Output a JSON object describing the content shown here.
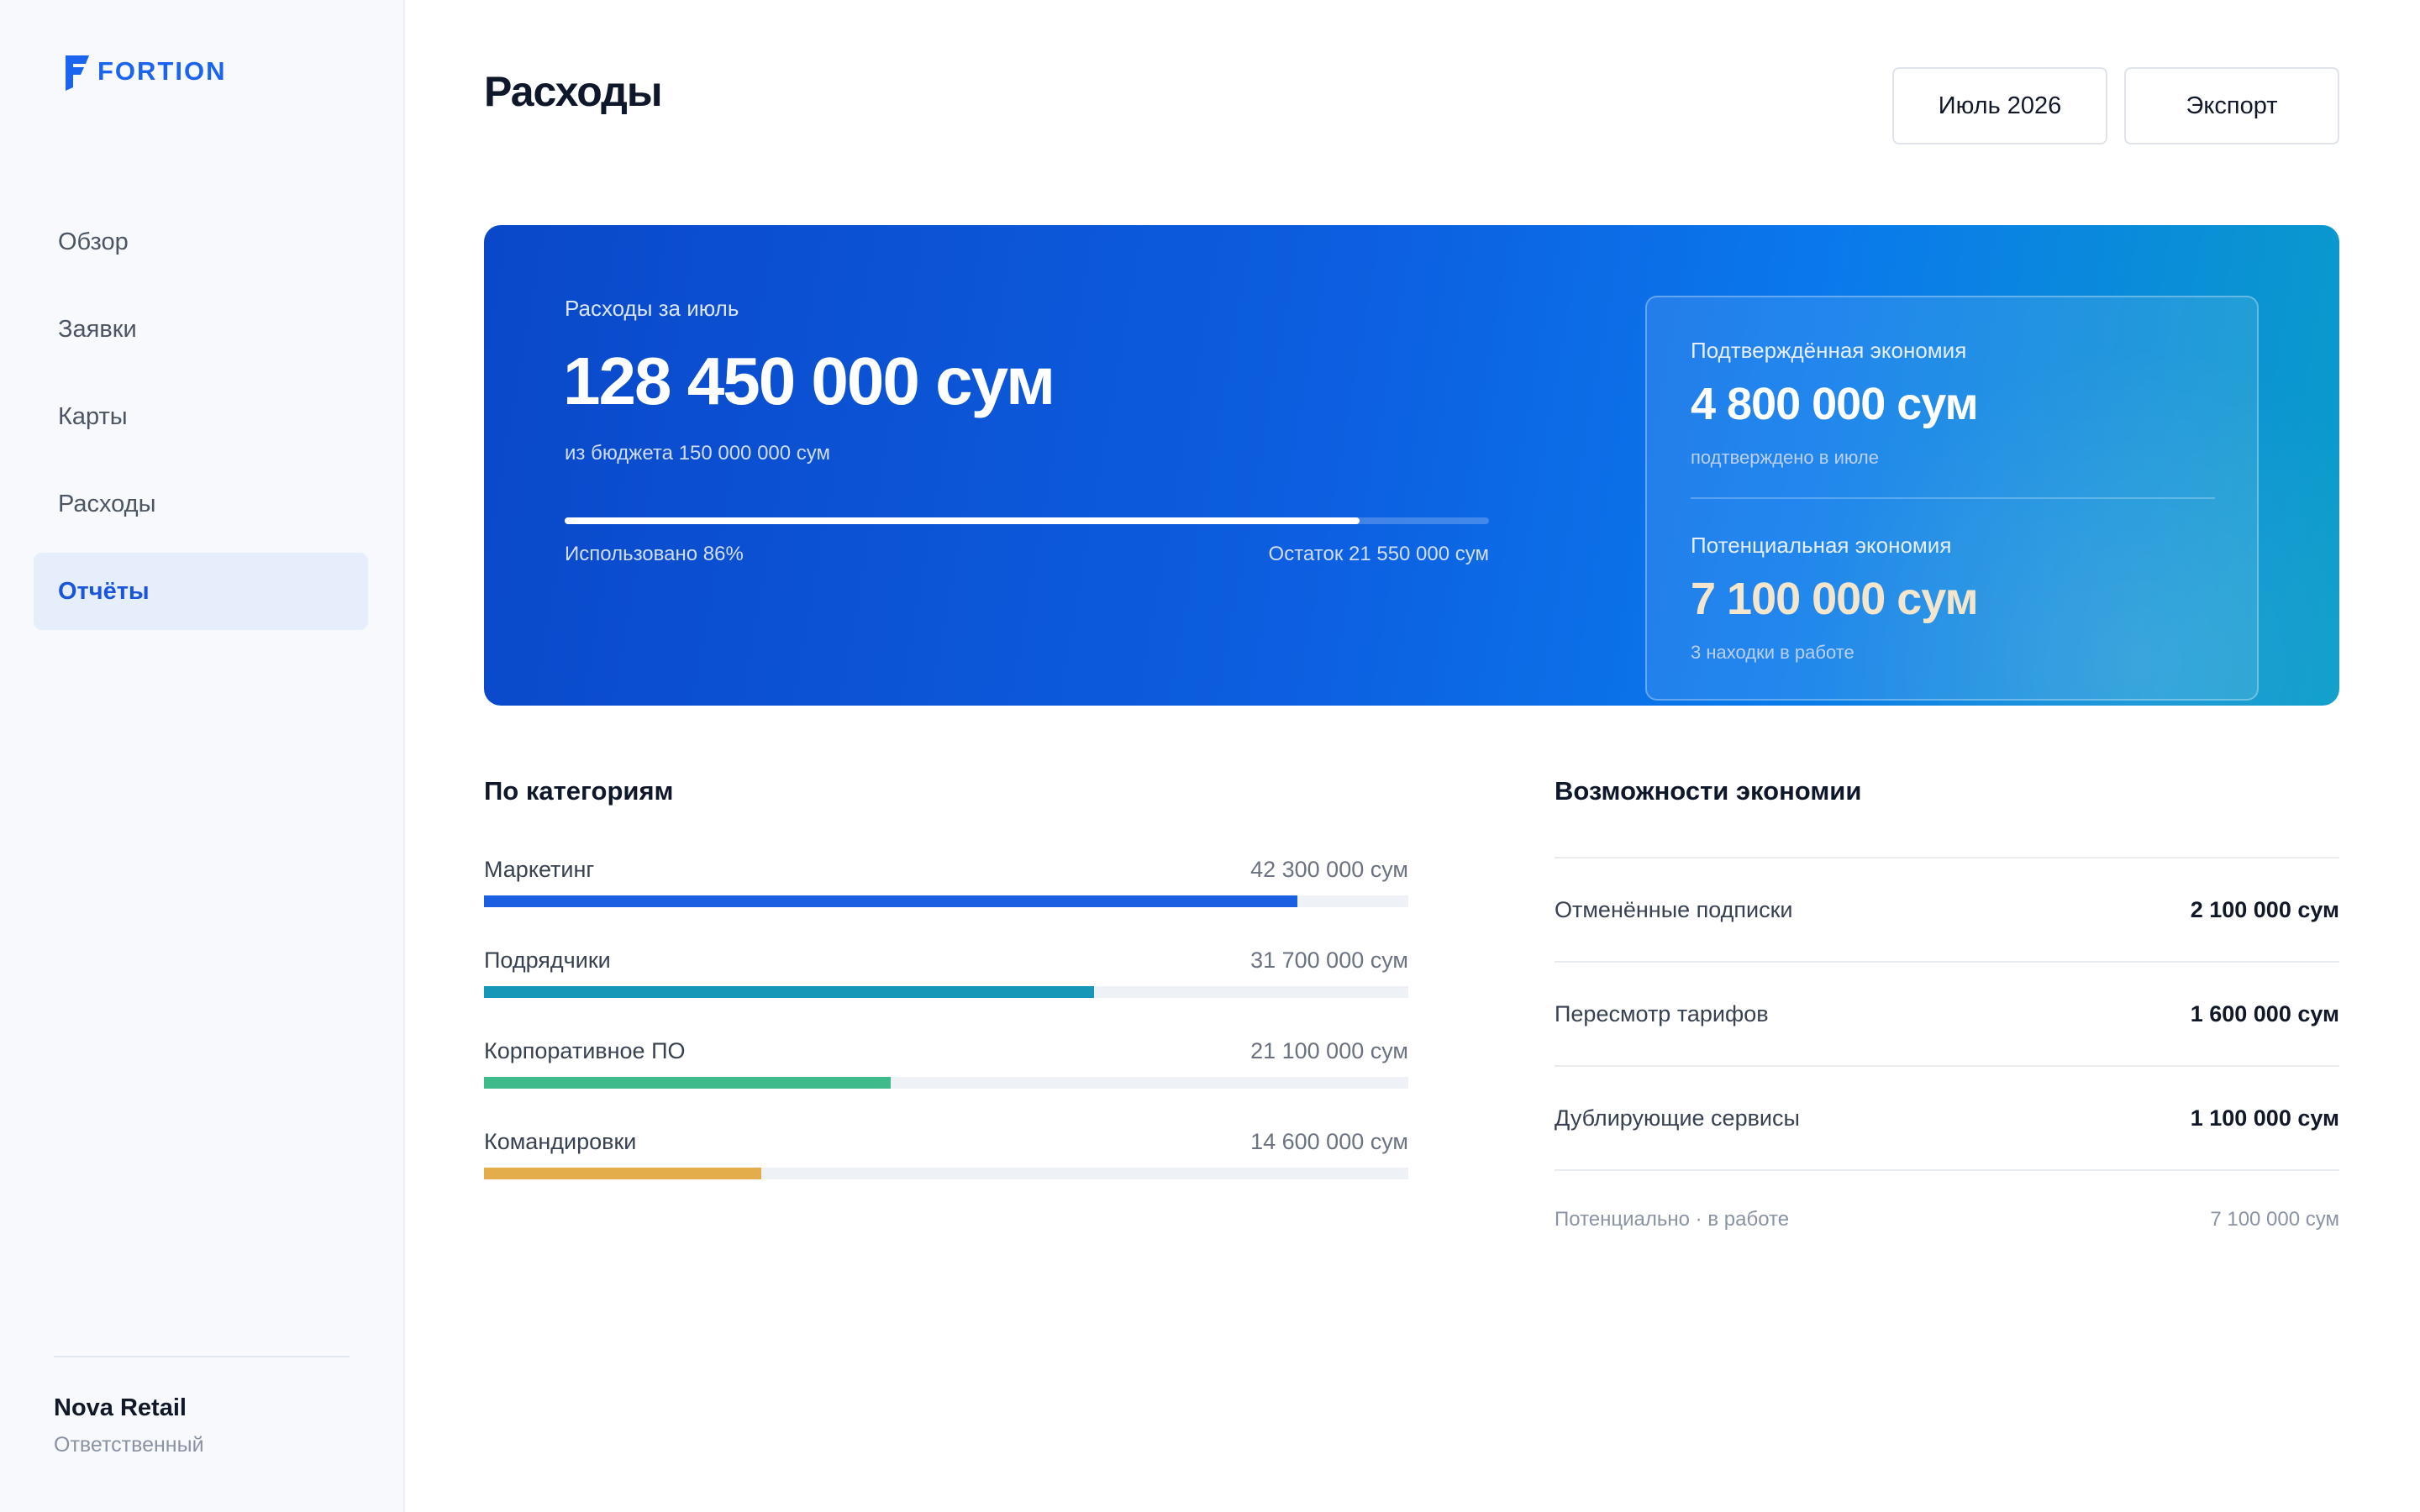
{
  "app": {
    "brand": "FORTION"
  },
  "sidebar": {
    "items": [
      {
        "label": "Обзор"
      },
      {
        "label": "Заявки"
      },
      {
        "label": "Карты"
      },
      {
        "label": "Расходы"
      },
      {
        "label": "Отчёты",
        "active": true
      }
    ],
    "org": {
      "name": "Nova Retail",
      "role": "Ответственный"
    }
  },
  "header": {
    "title": "Расходы",
    "month_button": "Июль 2026",
    "export_button": "Экспорт"
  },
  "summary": {
    "label": "Расходы за июль",
    "amount": "128 450 000 сум",
    "budget_note": "из бюджета 150 000 000 сум",
    "used_label": "Использовано 86%",
    "used_fraction": 0.86,
    "remaining_label": "Остаток 21 550 000 сум",
    "confirmed": {
      "label": "Подтверждённая экономия",
      "amount": "4 800 000 сум",
      "note": "подтверждено в июле"
    },
    "potential": {
      "label": "Потенциальная экономия",
      "amount": "7 100 000 сум",
      "note": "3 находки в работе"
    }
  },
  "categories": {
    "title": "По категориям",
    "items": [
      {
        "name": "Маркетинг",
        "value": "42 300 000 сум",
        "fraction": 0.88,
        "color": "#1a5fe0"
      },
      {
        "name": "Подрядчики",
        "value": "31 700 000 сум",
        "fraction": 0.66,
        "color": "#1797b8"
      },
      {
        "name": "Корпоративное ПО",
        "value": "21 100 000 сум",
        "fraction": 0.44,
        "color": "#3dbb8a"
      },
      {
        "name": "Командировки",
        "value": "14 600 000 сум",
        "fraction": 0.3,
        "color": "#e2ad4a"
      }
    ]
  },
  "savings": {
    "title": "Возможности экономии",
    "items": [
      {
        "name": "Отменённые подписки",
        "value": "2 100 000 сум"
      },
      {
        "name": "Пересмотр тарифов",
        "value": "1 600 000 сум"
      },
      {
        "name": "Дублирующие сервисы",
        "value": "1 100 000 сум"
      }
    ],
    "footer_label": "Потенциально · в работе",
    "footer_value": "7 100 000 сум"
  },
  "colors": {
    "accent": "#1a64f0",
    "confirmed_amount": "#ffffff",
    "potential_amount": "#f3e6cc"
  }
}
